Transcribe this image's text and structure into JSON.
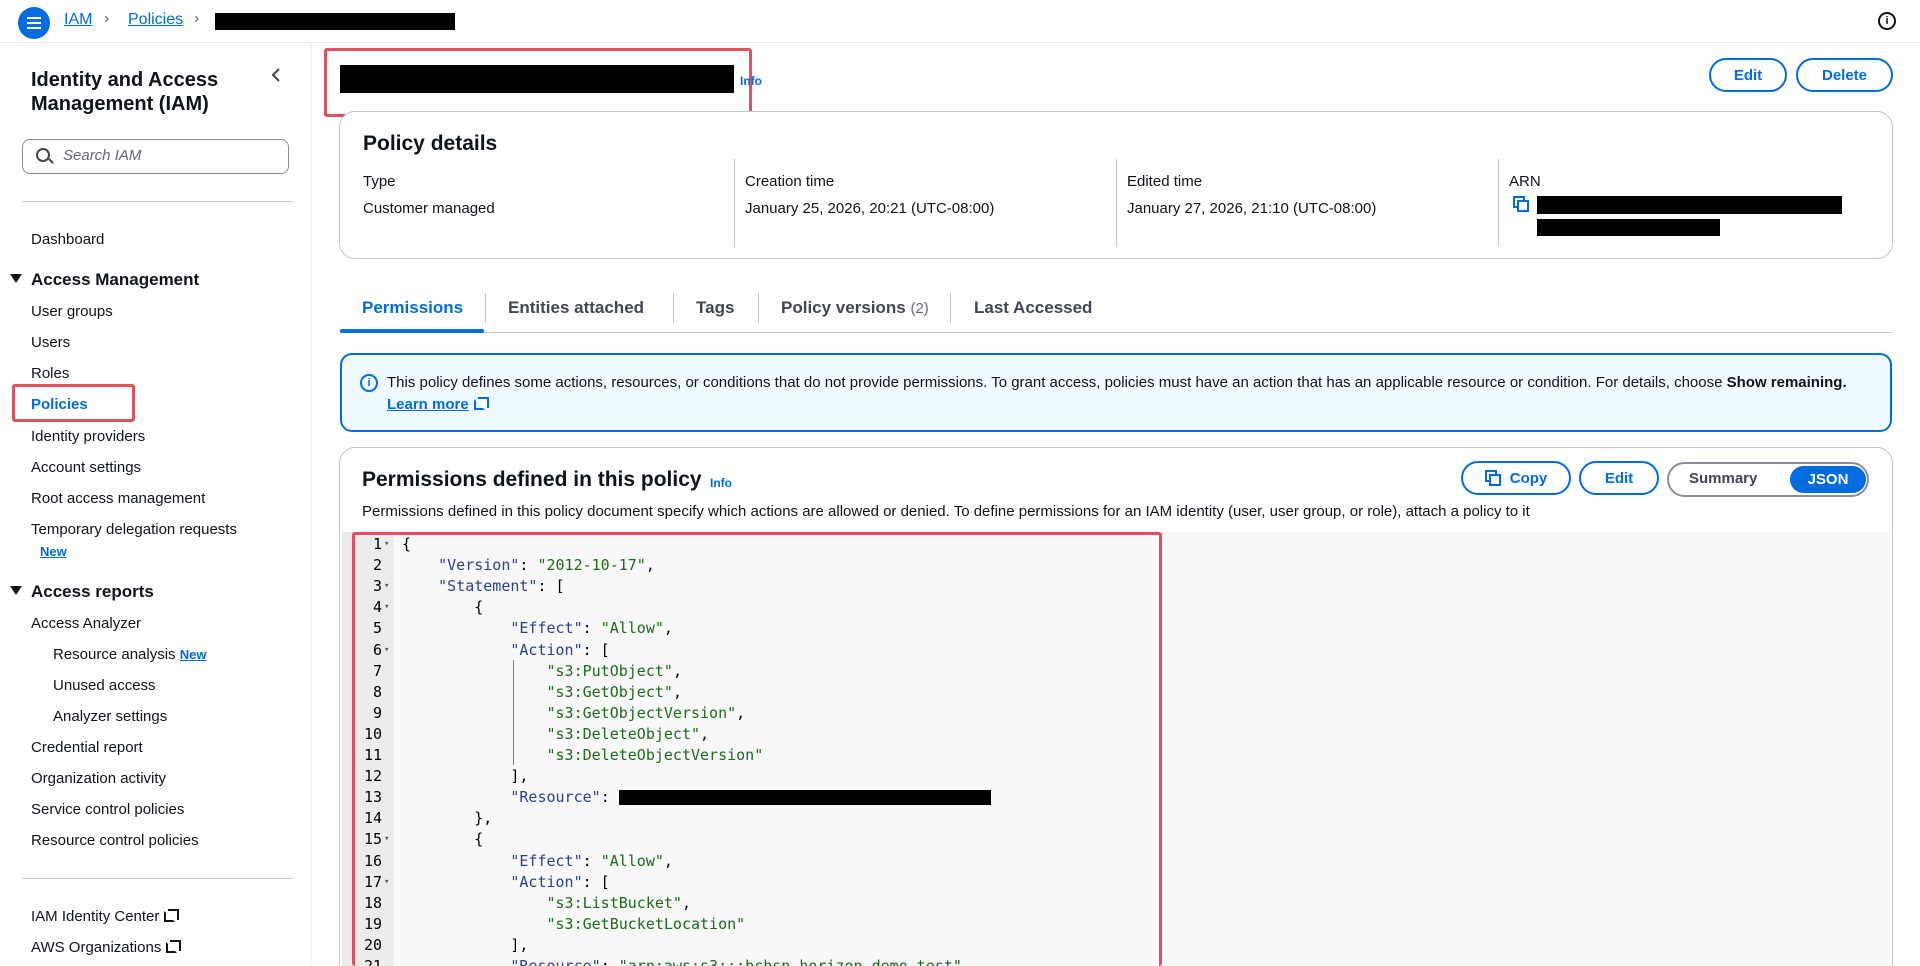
{
  "breadcrumb": {
    "items": [
      "IAM",
      "Policies"
    ]
  },
  "sidebar": {
    "title": "Identity and Access Management (IAM)",
    "search_placeholder": "Search IAM",
    "dashboard": "Dashboard",
    "access_management": {
      "heading": "Access Management",
      "items": [
        "User groups",
        "Users",
        "Roles",
        "Policies",
        "Identity providers",
        "Account settings",
        "Root access management",
        "Temporary delegation requests"
      ],
      "new_badge": "New"
    },
    "access_reports": {
      "heading": "Access reports",
      "items": [
        "Access Analyzer",
        "Resource analysis",
        "Unused access",
        "Analyzer settings",
        "Credential report",
        "Organization activity",
        "Service control policies",
        "Resource control policies"
      ],
      "new_badge": "New"
    },
    "external_links": [
      "IAM Identity Center",
      "AWS Organizations"
    ]
  },
  "header": {
    "info_label": "Info",
    "edit_label": "Edit",
    "delete_label": "Delete"
  },
  "policy_details": {
    "title": "Policy details",
    "type_label": "Type",
    "type_value": "Customer managed",
    "creation_label": "Creation time",
    "creation_value": "January 25, 2026, 20:21 (UTC-08:00)",
    "edited_label": "Edited time",
    "edited_value": "January 27, 2026, 21:10 (UTC-08:00)",
    "arn_label": "ARN"
  },
  "tabs": {
    "permissions": "Permissions",
    "entities": "Entities attached",
    "tags": "Tags",
    "versions": "Policy versions",
    "versions_count": "(2)",
    "last_accessed": "Last Accessed"
  },
  "alert": {
    "text": "This policy defines some actions, resources, or conditions that do not provide permissions. To grant access, policies must have an action that has an applicable resource or condition. For details, choose ",
    "bold": "Show remaining.",
    "link": "Learn more"
  },
  "permissions": {
    "title": "Permissions defined in this policy",
    "info_label": "Info",
    "copy_label": "Copy",
    "edit_label": "Edit",
    "summary_label": "Summary",
    "json_label": "JSON",
    "description": "Permissions defined in this policy document specify which actions are allowed or denied. To define permissions for an IAM identity (user, user group, or role), attach a policy to it"
  },
  "code_lines": [
    "{",
    "    \"Version\": \"2012-10-17\",",
    "    \"Statement\": [",
    "        {",
    "            \"Effect\": \"Allow\",",
    "            \"Action\": [",
    "                \"s3:PutObject\",",
    "                \"s3:GetObject\",",
    "                \"s3:GetObjectVersion\",",
    "                \"s3:DeleteObject\",",
    "                \"s3:DeleteObjectVersion\"",
    "            ],",
    "            \"Resource\": ",
    "        },",
    "        {",
    "            \"Effect\": \"Allow\",",
    "            \"Action\": [",
    "                \"s3:ListBucket\",",
    "                \"s3:GetBucketLocation\"",
    "            ],",
    "            \"Resource\": \"arn:aws:s3:::bcbsn-horizon-demo-test\","
  ],
  "colors": {
    "accent": "#006ce0",
    "highlight": "#e0505d",
    "alert_bg": "#f0fbff"
  }
}
